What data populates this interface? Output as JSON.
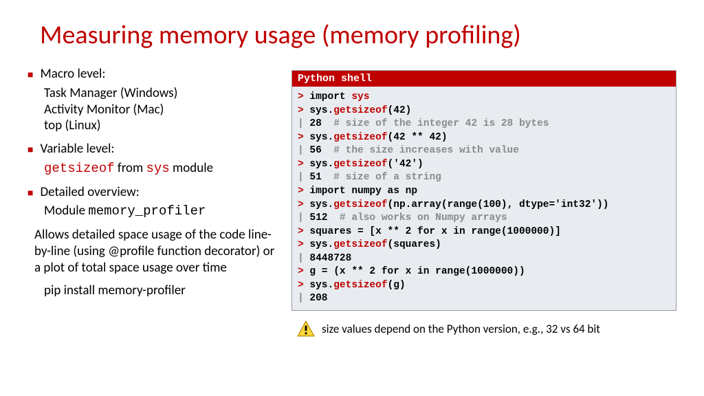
{
  "title": "Measuring memory usage (memory profiling)",
  "left": {
    "b1": "Macro level:",
    "b1s1": "Task Manager (Windows)",
    "b1s2": "Activity Monitor (Mac)",
    "b1s3": "top (Linux)",
    "b2": "Variable level:",
    "b2s_pre": "getsizeof",
    "b2s_mid": " from ",
    "b2s_post": "sys",
    "b2s_end": " module",
    "b3": "Detailed overview:",
    "b3s1_pre": "Module ",
    "b3s1_mono": "memory_profiler",
    "b3s2": "Allows detailed space usage of the code line-by-line (using @profile function decorator) or a plot of total space usage over time",
    "b3s3": "pip install memory-profiler"
  },
  "shell": {
    "header": "Python shell",
    "lines": [
      {
        "t": "prompt",
        "a": "> ",
        "b": "import ",
        "c": "sys"
      },
      {
        "t": "call",
        "a": "> ",
        "b": "sys.",
        "c": "getsizeof",
        "d": "(42)"
      },
      {
        "t": "out",
        "a": "| ",
        "b": "28",
        "c": "  # size of the integer 42 is 28 bytes"
      },
      {
        "t": "call",
        "a": "> ",
        "b": "sys.",
        "c": "getsizeof",
        "d": "(42 ** 42)"
      },
      {
        "t": "out",
        "a": "| ",
        "b": "56",
        "c": "  # the size increases with value"
      },
      {
        "t": "call",
        "a": "> ",
        "b": "sys.",
        "c": "getsizeof",
        "d": "('42')"
      },
      {
        "t": "out",
        "a": "| ",
        "b": "51",
        "c": "  # size of a string"
      },
      {
        "t": "plain",
        "a": "> ",
        "b": "import numpy as np"
      },
      {
        "t": "call",
        "a": "> ",
        "b": "sys.",
        "c": "getsizeof",
        "d": "(np.array(range(100), dtype='int32'))"
      },
      {
        "t": "out",
        "a": "| ",
        "b": "512",
        "c": "  # also works on Numpy arrays"
      },
      {
        "t": "plain",
        "a": "> ",
        "b": "squares = [x ** 2 for x in range(1000000)]"
      },
      {
        "t": "call",
        "a": "> ",
        "b": "sys.",
        "c": "getsizeof",
        "d": "(squares)"
      },
      {
        "t": "out",
        "a": "| ",
        "b": "8448728",
        "c": ""
      },
      {
        "t": "plain",
        "a": "> ",
        "b": "g = (x ** 2 for x in range(1000000))"
      },
      {
        "t": "call",
        "a": "> ",
        "b": "sys.",
        "c": "getsizeof",
        "d": "(g)"
      },
      {
        "t": "out",
        "a": "| ",
        "b": "208",
        "c": ""
      }
    ]
  },
  "footnote": "size values depend on the Python version, e.g., 32 vs 64 bit"
}
